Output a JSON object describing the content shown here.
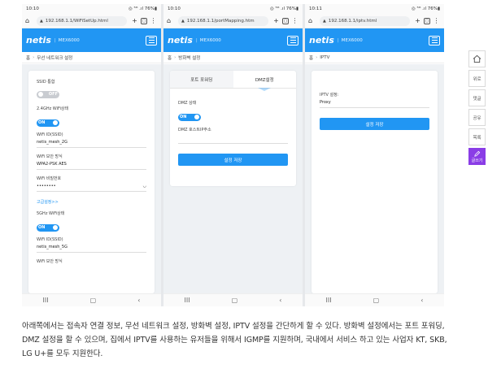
{
  "phones": [
    {
      "status": {
        "time": "10:10",
        "icons": "◎ ⁵ᴳ .ıl 76%▮"
      },
      "url": "192.168.1.1/WiFiSetUp.html",
      "brand": "netis",
      "model": "MEX6000",
      "breadcrumb": {
        "home": "홈",
        "page": "무선 네트워크 설정"
      },
      "fields": {
        "ssid_hide_label": "SSID 통합",
        "ssid_hide_toggle": "OFF",
        "wifi24_status_label": "2.4GHz WiFi상태",
        "wifi24_toggle": "ON",
        "wifi24_ssid_label": "WiFi ID(SSID)",
        "wifi24_ssid_value": "netis_mesh_2G",
        "wifi24_security_label": "WiFi 보안 방식",
        "wifi24_security_value": "WPA2-PSK AES",
        "wifi24_password_label": "WiFi 비밀번호",
        "wifi24_password_value": "••••••••",
        "advanced_link": "고급설정>>",
        "wifi5_status_label": "5GHz WiFi상태",
        "wifi5_toggle": "ON",
        "wifi5_ssid_label": "WiFi ID(SSID)",
        "wifi5_ssid_value": "netis_mesh_5G",
        "wifi5_security_label": "WiFi 보안 방식"
      }
    },
    {
      "status": {
        "time": "10:10",
        "icons": "◎ ⁵ᴳ .ıl 76%▮"
      },
      "url": "192.168.1.1/portMapping.htm",
      "brand": "netis",
      "model": "MEX6000",
      "breadcrumb": {
        "home": "홈",
        "page": "방화벽 설정"
      },
      "tabs": [
        "포트 포워딩",
        "DMZ설정"
      ],
      "fields": {
        "dmz_status_label": "DMZ 상태",
        "dmz_toggle": "ON",
        "dmz_host_label": "DMZ 호스트IP주소",
        "save_button": "설정 저장"
      }
    },
    {
      "status": {
        "time": "10:11",
        "icons": "◎ ⁵ᴳ .ıl 76%▮"
      },
      "url": "192.168.1.1/iptv.html",
      "brand": "netis",
      "model": "MEX6000",
      "breadcrumb": {
        "home": "홈",
        "page": "IPTV"
      },
      "fields": {
        "iptv_label": "IPTV 설정:",
        "iptv_value": "Proxy",
        "save_button": "설정 저장"
      }
    }
  ],
  "browser_icons": {
    "home": "⌂",
    "lock": "▲",
    "plus": "+",
    "more": "⋮"
  },
  "nav_icons": {
    "recent": "III",
    "home": "▢",
    "back": "‹"
  },
  "rail": {
    "home_icon": "home-outline-icon",
    "comments": "댓글",
    "share": "공유",
    "list": "목록",
    "write": "글쓰기",
    "likes": "위로"
  },
  "article": {
    "text": "아래쪽에서는 접속자 연결 정보, 무선 네트워크 설정, 방화벽 설정, IPTV 설정을 간단하게 할 수 있다. 방화벽 설정에서는 포트 포워딩, DMZ 설정을 할 수 있으며, 집에서 IPTV를 사용하는 유저들을 위해서 IGMP를 지원하며, 국내에서 서비스 하고 있는 사업자 KT, SKB, LG U+를 모두 지원한다."
  },
  "colors": {
    "accent": "#2196f3",
    "write_button": "#8a3de6"
  }
}
